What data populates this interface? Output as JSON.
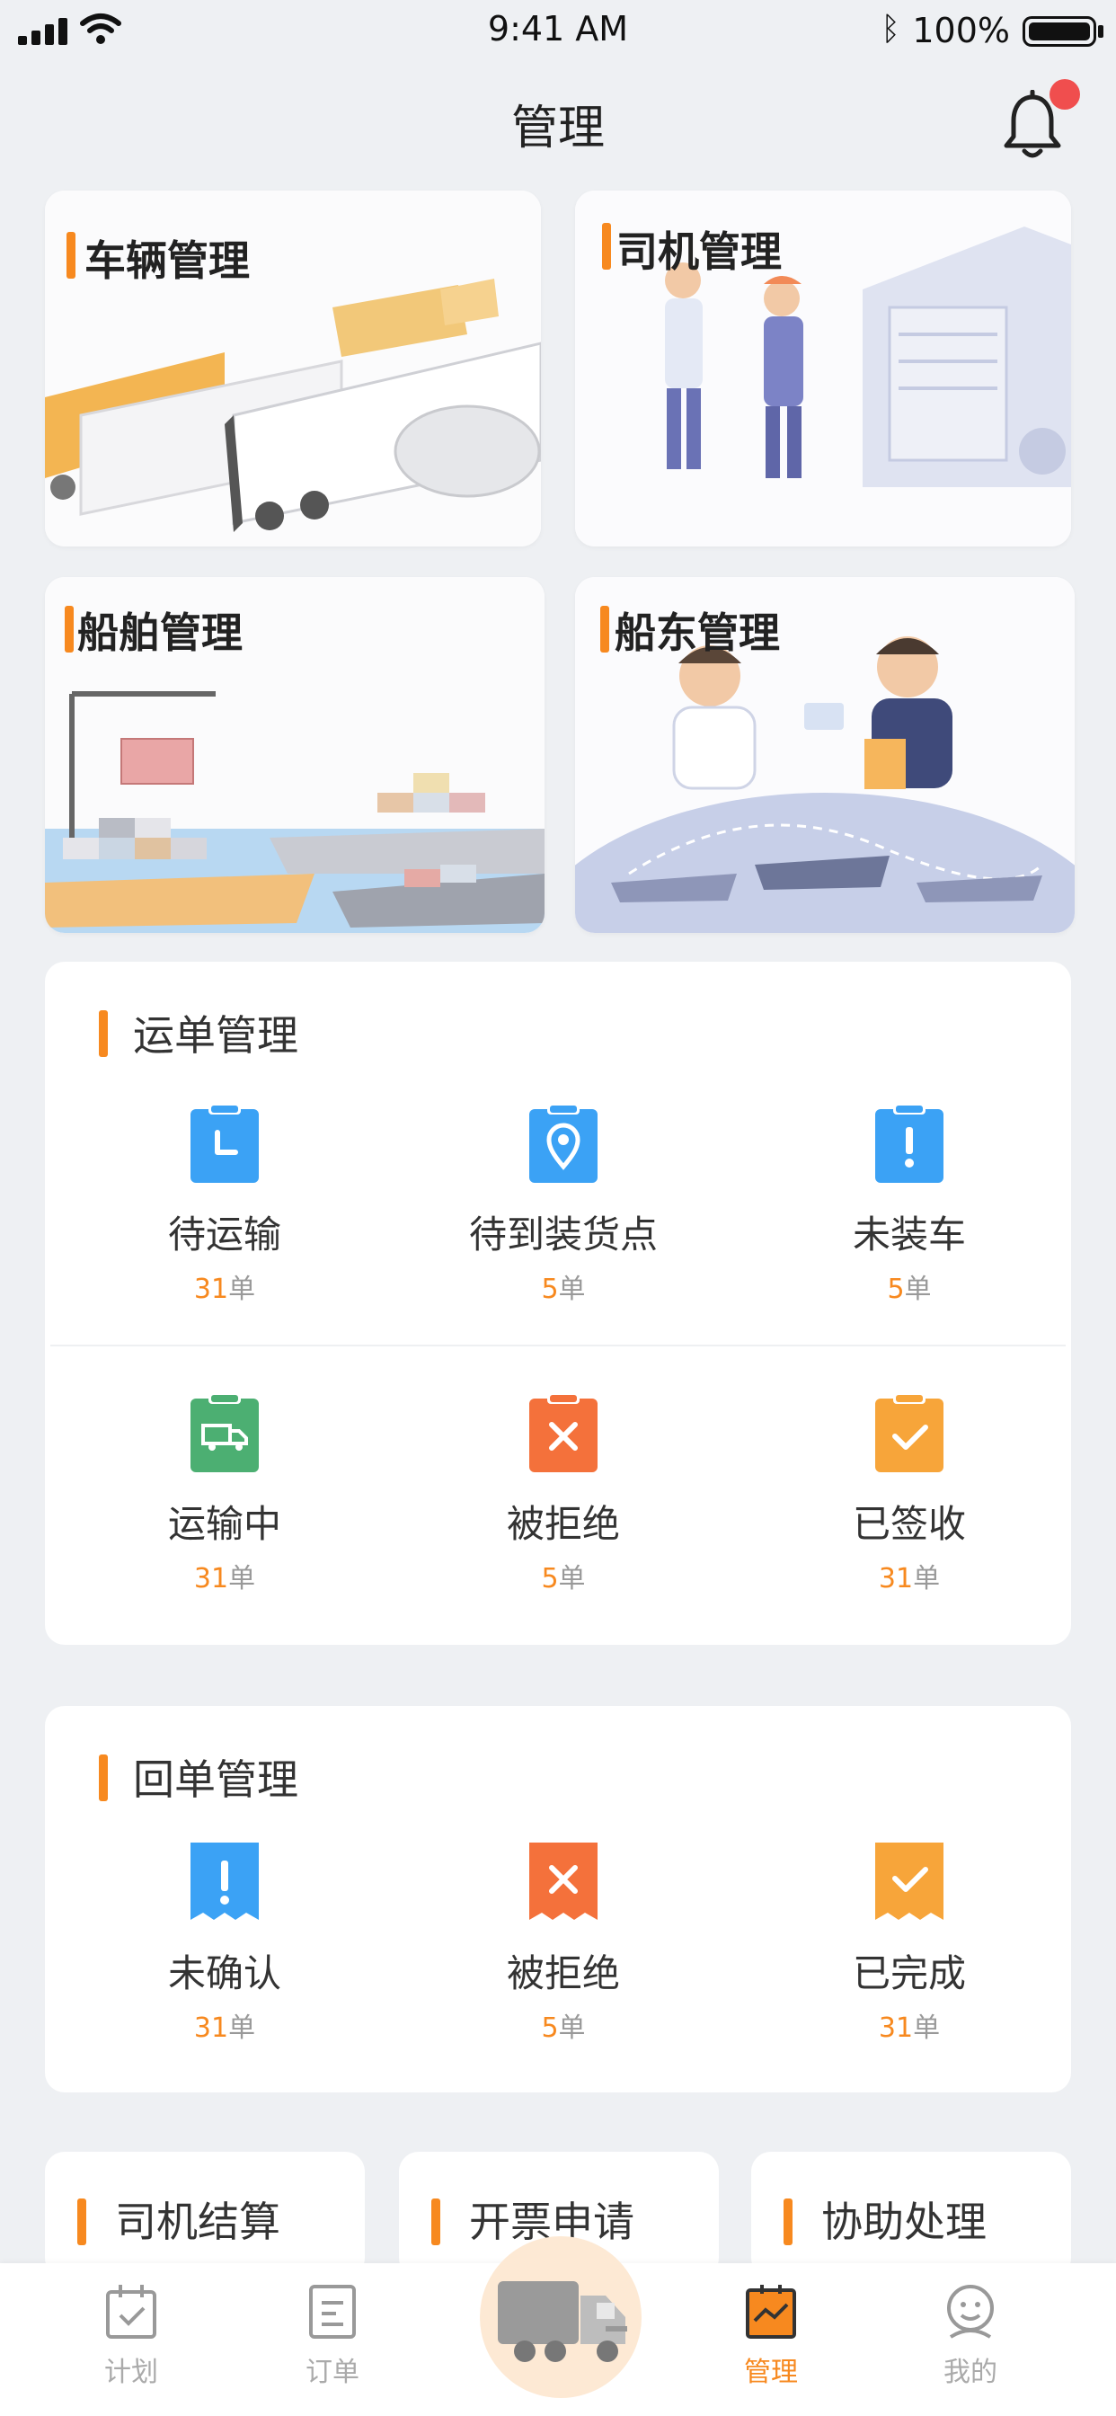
{
  "status_bar": {
    "time": "9:41 AM",
    "battery": "100%"
  },
  "header": {
    "title": "管理"
  },
  "image_cards": [
    {
      "label": "车辆管理"
    },
    {
      "label": "司机管理"
    },
    {
      "label": "船舶管理"
    },
    {
      "label": "船东管理"
    }
  ],
  "waybill": {
    "title": "运单管理",
    "unit": "单",
    "items": [
      {
        "name": "待运输",
        "count": "31",
        "icon": "clipboard-clock-icon",
        "color": "#3ba2f5"
      },
      {
        "name": "待到装货点",
        "count": "5",
        "icon": "clipboard-location-icon",
        "color": "#3ba2f5"
      },
      {
        "name": "未装车",
        "count": "5",
        "icon": "clipboard-exclamation-icon",
        "color": "#3ba2f5"
      },
      {
        "name": "运输中",
        "count": "31",
        "icon": "clipboard-truck-icon",
        "color": "#4caf72"
      },
      {
        "name": "被拒绝",
        "count": "5",
        "icon": "clipboard-x-icon",
        "color": "#f4713b"
      },
      {
        "name": "已签收",
        "count": "31",
        "icon": "clipboard-check-icon",
        "color": "#f7a53a"
      }
    ]
  },
  "receipt": {
    "title": "回单管理",
    "unit": "单",
    "items": [
      {
        "name": "未确认",
        "count": "31",
        "icon": "receipt-exclamation-icon",
        "color": "#3ba2f5"
      },
      {
        "name": "被拒绝",
        "count": "5",
        "icon": "receipt-x-icon",
        "color": "#f4713b"
      },
      {
        "name": "已完成",
        "count": "31",
        "icon": "receipt-check-icon",
        "color": "#f7a53a"
      }
    ]
  },
  "mini_cards": [
    {
      "label": "司机结算"
    },
    {
      "label": "开票申请"
    },
    {
      "label": "协助处理"
    }
  ],
  "tabs": [
    {
      "label": "计划",
      "icon": "calendar-check-icon"
    },
    {
      "label": "订单",
      "icon": "document-icon"
    },
    {
      "label": "管理",
      "icon": "chart-board-icon",
      "active": true
    },
    {
      "label": "我的",
      "icon": "user-icon"
    }
  ],
  "colors": {
    "accent": "#f7891f",
    "blue": "#3ba2f5",
    "green": "#4caf72",
    "red": "#f4713b",
    "amber": "#f7a53a"
  }
}
